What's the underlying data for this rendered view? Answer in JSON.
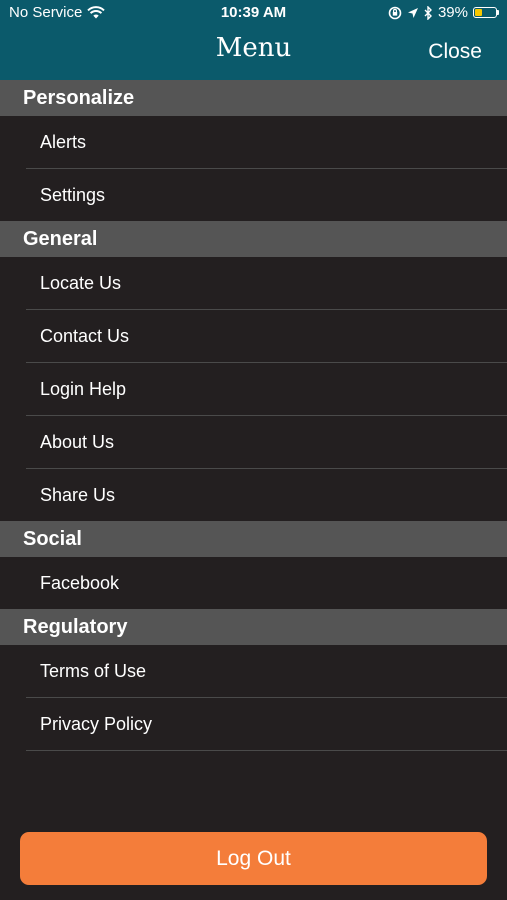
{
  "status_bar": {
    "carrier": "No Service",
    "time": "10:39 AM",
    "battery": "39%",
    "battery_level": 0.39,
    "battery_color": "#f6c800",
    "icons": [
      "wifi-icon",
      "screen-lock-icon",
      "location-icon",
      "bluetooth-icon",
      "battery-icon"
    ]
  },
  "header": {
    "title": "Menu",
    "close_label": "Close",
    "background": "#0b5a6b"
  },
  "sections": {
    "personalize": {
      "title": "Personalize",
      "items": [
        "Alerts",
        "Settings"
      ]
    },
    "general": {
      "title": "General",
      "items": [
        "Locate Us",
        "Contact Us",
        "Login Help",
        "About Us",
        "Share Us"
      ]
    },
    "social": {
      "title": "Social",
      "items": [
        "Facebook"
      ]
    },
    "regulatory": {
      "title": "Regulatory",
      "items": [
        "Terms of Use",
        "Privacy Policy"
      ]
    }
  },
  "logout": {
    "label": "Log Out",
    "color": "#f47d3a"
  }
}
